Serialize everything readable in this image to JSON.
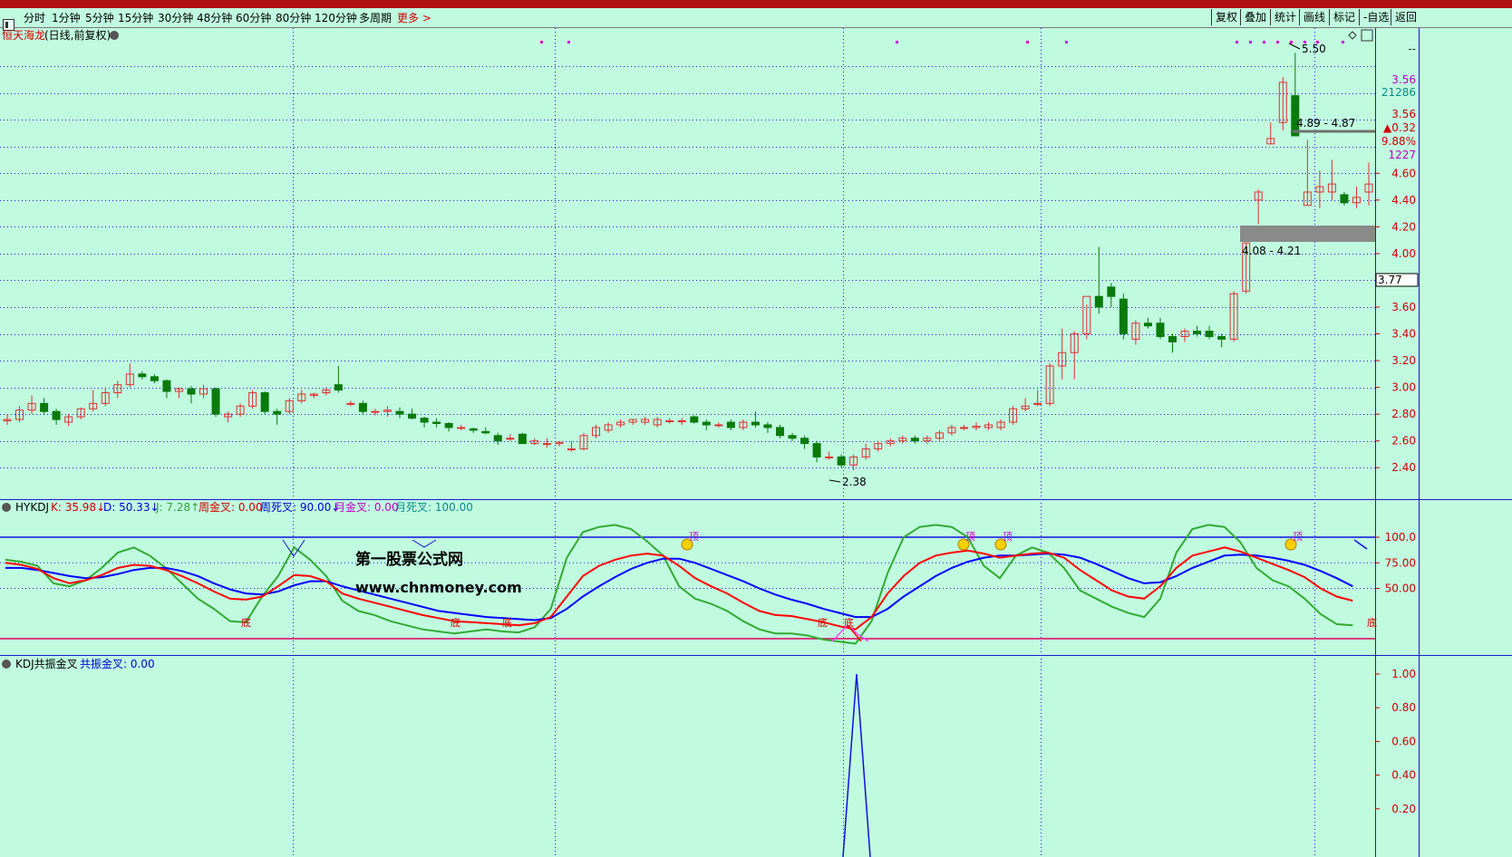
{
  "toolbar": {
    "periods": [
      "分时",
      "1分钟",
      "5分钟",
      "15分钟",
      "30分钟",
      "48分钟",
      "60分钟",
      "80分钟",
      "120分钟",
      "多周期"
    ],
    "more": "更多 >",
    "right_buttons": [
      "复权",
      "叠加",
      "统计",
      "画线",
      "标记",
      "-自选",
      "返回"
    ]
  },
  "main_panel": {
    "stock_name": "恒天海龙",
    "period_label": "(日线,前复权)",
    "y_ticks": [
      "4.60",
      "4.40",
      "4.20",
      "4.00",
      "3.80",
      "3.60",
      "3.40",
      "3.20",
      "3.00",
      "2.80",
      "2.60",
      "2.40"
    ],
    "side_info": [
      "--",
      "3.56",
      "21286",
      "3.56",
      "▲0.32",
      "9.88%",
      "1227"
    ],
    "current_price_box": "3.77",
    "annotations": {
      "high": "5.50",
      "low": "2.38",
      "range_upper": "4.89 - 4.87",
      "range_lower": "4.08 - 4.21"
    }
  },
  "indicator_panel": {
    "name": "HYKDJ",
    "values": [
      {
        "label": "K: 35.98↓",
        "color": "#d00000"
      },
      {
        "label": "D: 50.33↓",
        "color": "#0000d0"
      },
      {
        "label": "J: 7.28↑",
        "color": "#3aa03a"
      },
      {
        "label": "周金叉: 0.00",
        "color": "#d00000"
      },
      {
        "label": "周死叉: 90.00↓",
        "color": "#0000d0"
      },
      {
        "label": "月金叉: 0.00",
        "color": "#c000c0"
      },
      {
        "label": "月死叉: 100.00",
        "color": "#0a8a8a"
      }
    ],
    "y_ticks": [
      "100.0",
      "75.00",
      "50.00"
    ],
    "bottom_marks": [
      "底",
      "底",
      "底",
      "底",
      "底",
      "底"
    ],
    "top_marks": [
      "顶",
      "顶",
      "顶",
      "顶"
    ],
    "watermark_title": "第一股票公式网",
    "watermark_url": "www.chnmoney.com"
  },
  "resonance_panel": {
    "name": "KDJ共振金叉",
    "value": "共振金叉: 0.00",
    "y_ticks": [
      "1.00",
      "0.80",
      "0.60",
      "0.40",
      "0.20"
    ]
  },
  "colors": {
    "background": "#c0fbe0",
    "up": "#e03030",
    "down": "#0a7a0a",
    "k_line": "#ff0000",
    "d_line": "#0000ff",
    "j_line": "#33aa33",
    "grid": "#1a1acc"
  },
  "chart_data": {
    "type": "candlestick",
    "ylim": [
      2.3,
      5.55
    ],
    "candles_ohlc": [
      [
        2.75,
        2.8,
        2.72,
        2.76
      ],
      [
        2.76,
        2.86,
        2.74,
        2.83
      ],
      [
        2.83,
        2.94,
        2.8,
        2.88
      ],
      [
        2.88,
        2.92,
        2.8,
        2.82
      ],
      [
        2.82,
        2.84,
        2.72,
        2.76
      ],
      [
        2.74,
        2.8,
        2.71,
        2.78
      ],
      [
        2.78,
        2.85,
        2.76,
        2.84
      ],
      [
        2.84,
        2.98,
        2.82,
        2.88
      ],
      [
        2.88,
        3.0,
        2.86,
        2.96
      ],
      [
        2.96,
        3.05,
        2.92,
        3.02
      ],
      [
        3.02,
        3.18,
        3.0,
        3.1
      ],
      [
        3.1,
        3.12,
        3.06,
        3.08
      ],
      [
        3.08,
        3.1,
        3.03,
        3.05
      ],
      [
        3.05,
        3.06,
        2.92,
        2.97
      ],
      [
        2.97,
        3.0,
        2.92,
        2.99
      ],
      [
        2.99,
        3.01,
        2.88,
        2.95
      ],
      [
        2.95,
        3.02,
        2.92,
        2.99
      ],
      [
        2.99,
        3.0,
        2.78,
        2.8
      ],
      [
        2.78,
        2.82,
        2.74,
        2.8
      ],
      [
        2.8,
        2.88,
        2.78,
        2.86
      ],
      [
        2.86,
        2.98,
        2.84,
        2.96
      ],
      [
        2.96,
        2.97,
        2.8,
        2.82
      ],
      [
        2.82,
        2.84,
        2.72,
        2.8
      ],
      [
        2.82,
        2.92,
        2.8,
        2.9
      ],
      [
        2.9,
        2.98,
        2.88,
        2.95
      ],
      [
        2.94,
        2.96,
        2.92,
        2.95
      ],
      [
        2.96,
        3.0,
        2.94,
        2.98
      ],
      [
        3.02,
        3.16,
        2.96,
        2.98
      ],
      [
        2.88,
        2.9,
        2.86,
        2.88
      ],
      [
        2.88,
        2.9,
        2.8,
        2.82
      ],
      [
        2.82,
        2.84,
        2.79,
        2.82
      ],
      [
        2.82,
        2.86,
        2.78,
        2.83
      ],
      [
        2.82,
        2.85,
        2.77,
        2.8
      ],
      [
        2.8,
        2.84,
        2.76,
        2.77
      ],
      [
        2.77,
        2.78,
        2.7,
        2.74
      ],
      [
        2.74,
        2.77,
        2.7,
        2.73
      ],
      [
        2.73,
        2.74,
        2.67,
        2.7
      ],
      [
        2.7,
        2.72,
        2.68,
        2.7
      ],
      [
        2.69,
        2.7,
        2.66,
        2.68
      ],
      [
        2.67,
        2.7,
        2.65,
        2.66
      ],
      [
        2.64,
        2.66,
        2.57,
        2.6
      ],
      [
        2.62,
        2.65,
        2.6,
        2.62
      ],
      [
        2.65,
        2.66,
        2.58,
        2.58
      ],
      [
        2.58,
        2.62,
        2.57,
        2.6
      ],
      [
        2.58,
        2.62,
        2.55,
        2.58
      ],
      [
        2.58,
        2.6,
        2.56,
        2.59
      ],
      [
        2.54,
        2.6,
        2.52,
        2.54
      ],
      [
        2.54,
        2.66,
        2.53,
        2.64
      ],
      [
        2.64,
        2.72,
        2.62,
        2.7
      ],
      [
        2.68,
        2.74,
        2.66,
        2.72
      ],
      [
        2.72,
        2.76,
        2.7,
        2.74
      ],
      [
        2.74,
        2.76,
        2.72,
        2.76
      ],
      [
        2.74,
        2.78,
        2.72,
        2.76
      ],
      [
        2.72,
        2.78,
        2.7,
        2.76
      ],
      [
        2.75,
        2.77,
        2.73,
        2.75
      ],
      [
        2.75,
        2.77,
        2.72,
        2.75
      ],
      [
        2.78,
        2.79,
        2.73,
        2.74
      ],
      [
        2.74,
        2.76,
        2.68,
        2.72
      ],
      [
        2.72,
        2.74,
        2.7,
        2.72
      ],
      [
        2.74,
        2.76,
        2.68,
        2.7
      ],
      [
        2.7,
        2.76,
        2.68,
        2.74
      ],
      [
        2.74,
        2.82,
        2.7,
        2.72
      ],
      [
        2.72,
        2.74,
        2.66,
        2.7
      ],
      [
        2.7,
        2.72,
        2.62,
        2.64
      ],
      [
        2.64,
        2.66,
        2.6,
        2.62
      ],
      [
        2.62,
        2.64,
        2.54,
        2.58
      ],
      [
        2.58,
        2.6,
        2.44,
        2.48
      ],
      [
        2.48,
        2.52,
        2.46,
        2.48
      ],
      [
        2.48,
        2.5,
        2.4,
        2.42
      ],
      [
        2.42,
        2.5,
        2.38,
        2.48
      ],
      [
        2.48,
        2.58,
        2.46,
        2.54
      ],
      [
        2.54,
        2.6,
        2.52,
        2.58
      ],
      [
        2.58,
        2.62,
        2.56,
        2.6
      ],
      [
        2.6,
        2.64,
        2.58,
        2.62
      ],
      [
        2.62,
        2.64,
        2.58,
        2.6
      ],
      [
        2.6,
        2.64,
        2.58,
        2.62
      ],
      [
        2.62,
        2.68,
        2.6,
        2.66
      ],
      [
        2.66,
        2.72,
        2.64,
        2.7
      ],
      [
        2.7,
        2.72,
        2.68,
        2.7
      ],
      [
        2.7,
        2.74,
        2.68,
        2.71
      ],
      [
        2.7,
        2.74,
        2.68,
        2.72
      ],
      [
        2.7,
        2.76,
        2.68,
        2.74
      ],
      [
        2.74,
        2.86,
        2.72,
        2.84
      ],
      [
        2.84,
        2.92,
        2.82,
        2.86
      ],
      [
        2.88,
        2.98,
        2.86,
        2.88
      ],
      [
        2.88,
        3.18,
        2.86,
        3.16
      ],
      [
        3.16,
        3.44,
        3.06,
        3.26
      ],
      [
        3.26,
        3.42,
        3.06,
        3.4
      ],
      [
        3.4,
        3.62,
        3.36,
        3.68
      ],
      [
        3.68,
        4.05,
        3.55,
        3.6
      ],
      [
        3.75,
        3.78,
        3.6,
        3.68
      ],
      [
        3.66,
        3.7,
        3.36,
        3.4
      ],
      [
        3.36,
        3.5,
        3.32,
        3.48
      ],
      [
        3.48,
        3.52,
        3.44,
        3.46
      ],
      [
        3.48,
        3.52,
        3.36,
        3.38
      ],
      [
        3.38,
        3.4,
        3.26,
        3.34
      ],
      [
        3.38,
        3.44,
        3.34,
        3.42
      ],
      [
        3.42,
        3.46,
        3.38,
        3.4
      ],
      [
        3.42,
        3.46,
        3.36,
        3.38
      ],
      [
        3.38,
        3.4,
        3.3,
        3.36
      ],
      [
        3.36,
        3.72,
        3.34,
        3.7
      ],
      [
        3.72,
        4.08,
        3.7,
        4.08
      ],
      [
        4.4,
        4.48,
        4.22,
        4.46
      ],
      [
        4.82,
        4.98,
        4.82,
        4.86
      ],
      [
        4.98,
        5.32,
        4.92,
        5.28
      ],
      [
        5.18,
        5.5,
        4.88,
        4.88
      ],
      [
        4.36,
        4.85,
        4.36,
        4.46
      ],
      [
        4.46,
        4.62,
        4.34,
        4.5
      ],
      [
        4.46,
        4.7,
        4.4,
        4.52
      ],
      [
        4.44,
        4.46,
        4.36,
        4.38
      ],
      [
        4.38,
        4.5,
        4.34,
        4.42
      ],
      [
        4.46,
        4.68,
        4.36,
        4.52
      ]
    ]
  }
}
